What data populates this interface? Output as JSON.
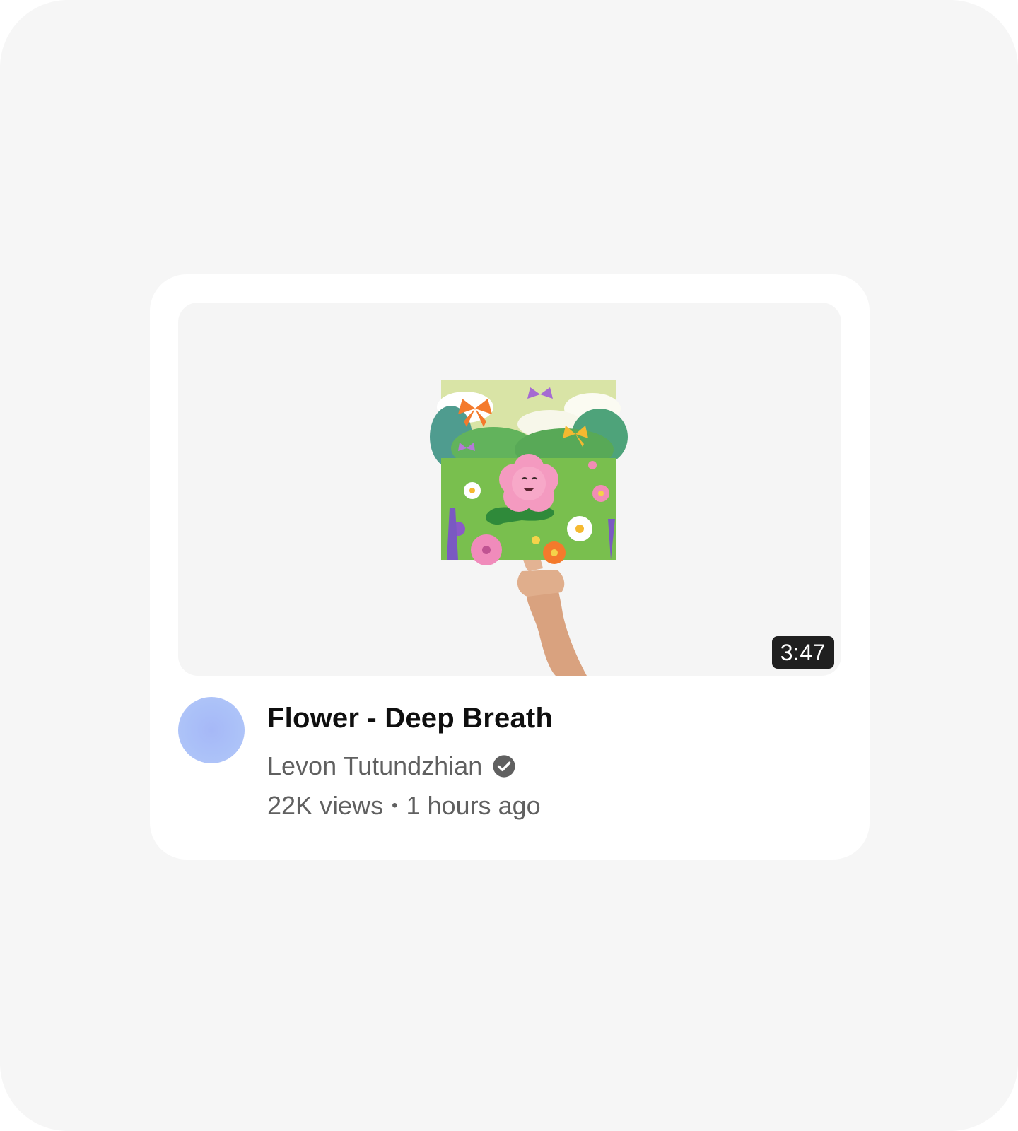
{
  "video": {
    "title": "Flower - Deep Breath",
    "duration": "3:47",
    "thumbnail_icon": "flower-album-art-held-by-hand"
  },
  "channel": {
    "name": "Levon Tutundzhian",
    "verified_icon": "check-circle-icon",
    "avatar_color": "#a9bdf7"
  },
  "stats": {
    "views": "22K views",
    "separator": "•",
    "posted": "1 hours ago"
  }
}
